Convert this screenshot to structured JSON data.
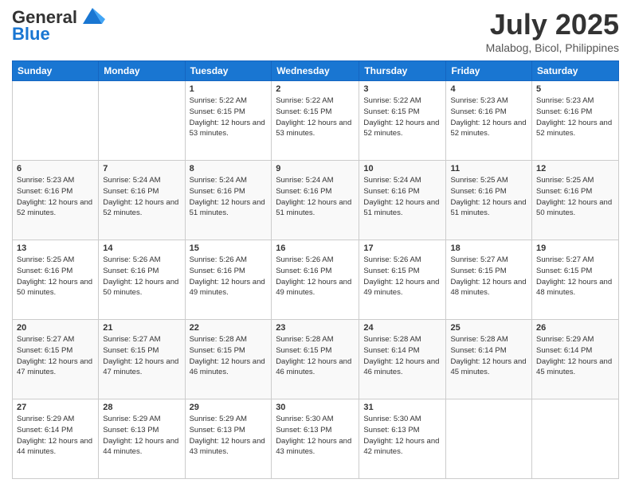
{
  "header": {
    "logo_line1": "General",
    "logo_line2": "Blue",
    "month_title": "July 2025",
    "location": "Malabog, Bicol, Philippines"
  },
  "days_of_week": [
    "Sunday",
    "Monday",
    "Tuesday",
    "Wednesday",
    "Thursday",
    "Friday",
    "Saturday"
  ],
  "weeks": [
    [
      {
        "day": "",
        "sunrise": "",
        "sunset": "",
        "daylight": ""
      },
      {
        "day": "",
        "sunrise": "",
        "sunset": "",
        "daylight": ""
      },
      {
        "day": "1",
        "sunrise": "Sunrise: 5:22 AM",
        "sunset": "Sunset: 6:15 PM",
        "daylight": "Daylight: 12 hours and 53 minutes."
      },
      {
        "day": "2",
        "sunrise": "Sunrise: 5:22 AM",
        "sunset": "Sunset: 6:15 PM",
        "daylight": "Daylight: 12 hours and 53 minutes."
      },
      {
        "day": "3",
        "sunrise": "Sunrise: 5:22 AM",
        "sunset": "Sunset: 6:15 PM",
        "daylight": "Daylight: 12 hours and 52 minutes."
      },
      {
        "day": "4",
        "sunrise": "Sunrise: 5:23 AM",
        "sunset": "Sunset: 6:16 PM",
        "daylight": "Daylight: 12 hours and 52 minutes."
      },
      {
        "day": "5",
        "sunrise": "Sunrise: 5:23 AM",
        "sunset": "Sunset: 6:16 PM",
        "daylight": "Daylight: 12 hours and 52 minutes."
      }
    ],
    [
      {
        "day": "6",
        "sunrise": "Sunrise: 5:23 AM",
        "sunset": "Sunset: 6:16 PM",
        "daylight": "Daylight: 12 hours and 52 minutes."
      },
      {
        "day": "7",
        "sunrise": "Sunrise: 5:24 AM",
        "sunset": "Sunset: 6:16 PM",
        "daylight": "Daylight: 12 hours and 52 minutes."
      },
      {
        "day": "8",
        "sunrise": "Sunrise: 5:24 AM",
        "sunset": "Sunset: 6:16 PM",
        "daylight": "Daylight: 12 hours and 51 minutes."
      },
      {
        "day": "9",
        "sunrise": "Sunrise: 5:24 AM",
        "sunset": "Sunset: 6:16 PM",
        "daylight": "Daylight: 12 hours and 51 minutes."
      },
      {
        "day": "10",
        "sunrise": "Sunrise: 5:24 AM",
        "sunset": "Sunset: 6:16 PM",
        "daylight": "Daylight: 12 hours and 51 minutes."
      },
      {
        "day": "11",
        "sunrise": "Sunrise: 5:25 AM",
        "sunset": "Sunset: 6:16 PM",
        "daylight": "Daylight: 12 hours and 51 minutes."
      },
      {
        "day": "12",
        "sunrise": "Sunrise: 5:25 AM",
        "sunset": "Sunset: 6:16 PM",
        "daylight": "Daylight: 12 hours and 50 minutes."
      }
    ],
    [
      {
        "day": "13",
        "sunrise": "Sunrise: 5:25 AM",
        "sunset": "Sunset: 6:16 PM",
        "daylight": "Daylight: 12 hours and 50 minutes."
      },
      {
        "day": "14",
        "sunrise": "Sunrise: 5:26 AM",
        "sunset": "Sunset: 6:16 PM",
        "daylight": "Daylight: 12 hours and 50 minutes."
      },
      {
        "day": "15",
        "sunrise": "Sunrise: 5:26 AM",
        "sunset": "Sunset: 6:16 PM",
        "daylight": "Daylight: 12 hours and 49 minutes."
      },
      {
        "day": "16",
        "sunrise": "Sunrise: 5:26 AM",
        "sunset": "Sunset: 6:16 PM",
        "daylight": "Daylight: 12 hours and 49 minutes."
      },
      {
        "day": "17",
        "sunrise": "Sunrise: 5:26 AM",
        "sunset": "Sunset: 6:15 PM",
        "daylight": "Daylight: 12 hours and 49 minutes."
      },
      {
        "day": "18",
        "sunrise": "Sunrise: 5:27 AM",
        "sunset": "Sunset: 6:15 PM",
        "daylight": "Daylight: 12 hours and 48 minutes."
      },
      {
        "day": "19",
        "sunrise": "Sunrise: 5:27 AM",
        "sunset": "Sunset: 6:15 PM",
        "daylight": "Daylight: 12 hours and 48 minutes."
      }
    ],
    [
      {
        "day": "20",
        "sunrise": "Sunrise: 5:27 AM",
        "sunset": "Sunset: 6:15 PM",
        "daylight": "Daylight: 12 hours and 47 minutes."
      },
      {
        "day": "21",
        "sunrise": "Sunrise: 5:27 AM",
        "sunset": "Sunset: 6:15 PM",
        "daylight": "Daylight: 12 hours and 47 minutes."
      },
      {
        "day": "22",
        "sunrise": "Sunrise: 5:28 AM",
        "sunset": "Sunset: 6:15 PM",
        "daylight": "Daylight: 12 hours and 46 minutes."
      },
      {
        "day": "23",
        "sunrise": "Sunrise: 5:28 AM",
        "sunset": "Sunset: 6:15 PM",
        "daylight": "Daylight: 12 hours and 46 minutes."
      },
      {
        "day": "24",
        "sunrise": "Sunrise: 5:28 AM",
        "sunset": "Sunset: 6:14 PM",
        "daylight": "Daylight: 12 hours and 46 minutes."
      },
      {
        "day": "25",
        "sunrise": "Sunrise: 5:28 AM",
        "sunset": "Sunset: 6:14 PM",
        "daylight": "Daylight: 12 hours and 45 minutes."
      },
      {
        "day": "26",
        "sunrise": "Sunrise: 5:29 AM",
        "sunset": "Sunset: 6:14 PM",
        "daylight": "Daylight: 12 hours and 45 minutes."
      }
    ],
    [
      {
        "day": "27",
        "sunrise": "Sunrise: 5:29 AM",
        "sunset": "Sunset: 6:14 PM",
        "daylight": "Daylight: 12 hours and 44 minutes."
      },
      {
        "day": "28",
        "sunrise": "Sunrise: 5:29 AM",
        "sunset": "Sunset: 6:13 PM",
        "daylight": "Daylight: 12 hours and 44 minutes."
      },
      {
        "day": "29",
        "sunrise": "Sunrise: 5:29 AM",
        "sunset": "Sunset: 6:13 PM",
        "daylight": "Daylight: 12 hours and 43 minutes."
      },
      {
        "day": "30",
        "sunrise": "Sunrise: 5:30 AM",
        "sunset": "Sunset: 6:13 PM",
        "daylight": "Daylight: 12 hours and 43 minutes."
      },
      {
        "day": "31",
        "sunrise": "Sunrise: 5:30 AM",
        "sunset": "Sunset: 6:13 PM",
        "daylight": "Daylight: 12 hours and 42 minutes."
      },
      {
        "day": "",
        "sunrise": "",
        "sunset": "",
        "daylight": ""
      },
      {
        "day": "",
        "sunrise": "",
        "sunset": "",
        "daylight": ""
      }
    ]
  ]
}
